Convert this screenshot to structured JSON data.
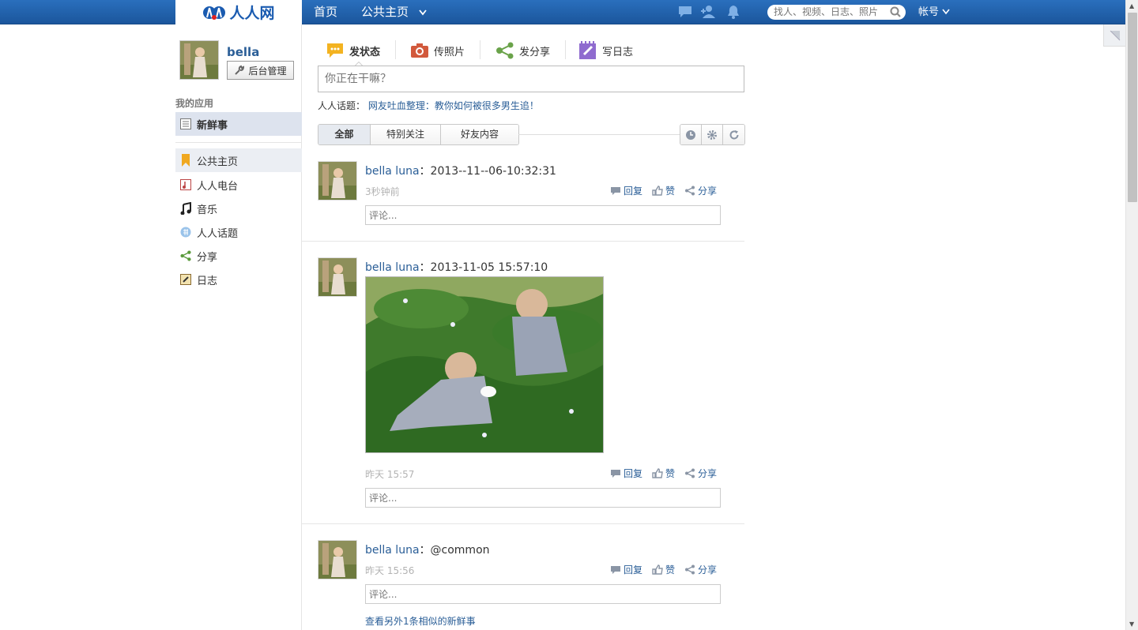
{
  "topbar": {
    "logo_text": "人人网",
    "nav_home": "首页",
    "nav_public": "公共主页",
    "search_placeholder": "找人、视频、日志、照片",
    "account": "帐号"
  },
  "sidebar": {
    "user_name": "bella",
    "admin_button": "后台管理",
    "apps_title": "我的应用",
    "items": [
      {
        "label": "新鲜事",
        "icon": "list-icon"
      },
      {
        "label": "公共主页",
        "icon": "bookmark-icon"
      },
      {
        "label": "人人电台",
        "icon": "radio-icon"
      },
      {
        "label": "音乐",
        "icon": "music-icon"
      },
      {
        "label": "人人话题",
        "icon": "topic-icon"
      },
      {
        "label": "分享",
        "icon": "share-icon"
      },
      {
        "label": "日志",
        "icon": "journal-icon"
      }
    ]
  },
  "publisher": {
    "tabs": [
      "发状态",
      "传照片",
      "发分享",
      "写日志"
    ],
    "input_placeholder": "你正在干嘛？",
    "topic_label": "人人话题：",
    "topic_link": "网友吐血整理：教你如何被很多男生追！"
  },
  "filters": {
    "tabs": [
      "全部",
      "特别关注",
      "好友内容"
    ]
  },
  "feed": {
    "posts": [
      {
        "author": "bella luna",
        "content": "：2013--11--06-10:32:31",
        "time": "3秒钟前"
      },
      {
        "author": "bella luna",
        "content": "：2013-11-05 15:57:10",
        "time": "昨天 15:57"
      },
      {
        "author": "bella luna",
        "content": "：@common",
        "time": "昨天 15:56"
      }
    ],
    "reply": "回复",
    "like": "赞",
    "share": "分享",
    "comment_placeholder": "评论...",
    "more_link": "查看另外1条相似的新鲜事"
  }
}
